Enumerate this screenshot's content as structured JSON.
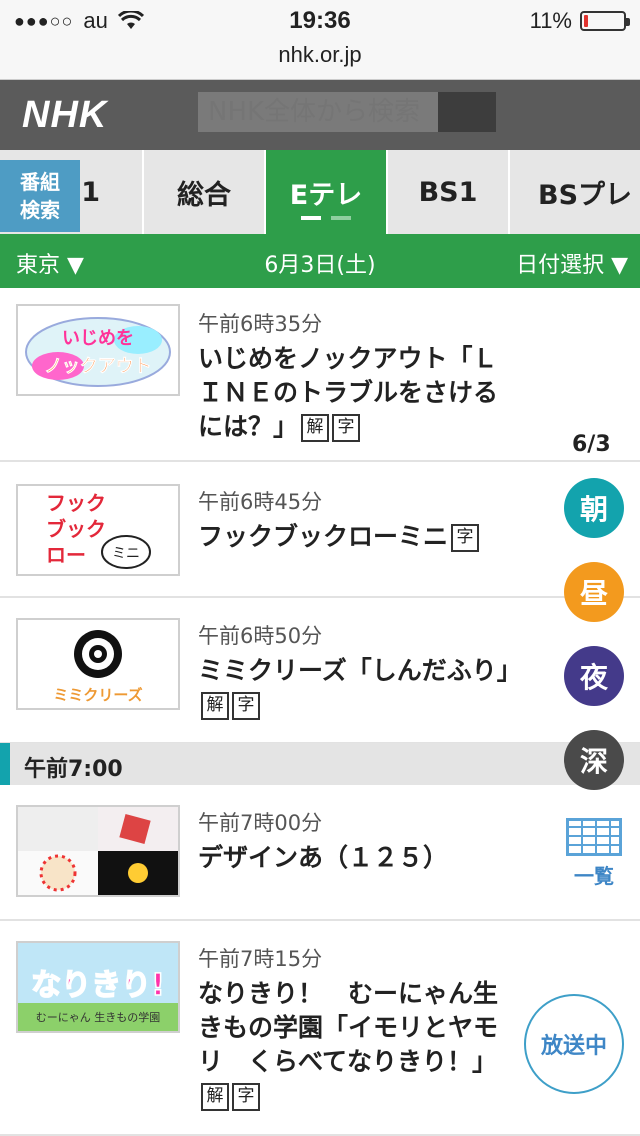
{
  "status": {
    "carrier": "au",
    "time": "19:36",
    "battery": "11%",
    "battery_level": 0.11,
    "signal": "●●●○○"
  },
  "browser": {
    "url": "nhk.or.jp"
  },
  "header": {
    "logo": "NHK",
    "search_placeholder": "NHK全体から検索"
  },
  "search_program": {
    "label_line1": "番組",
    "label_line2": "検索"
  },
  "tabs": [
    {
      "label": "1",
      "active": false
    },
    {
      "label": "総合",
      "active": false
    },
    {
      "label": "Eテレ",
      "active": true
    },
    {
      "label": "BS1",
      "active": false
    },
    {
      "label": "BSプレ",
      "active": false
    }
  ],
  "datebar": {
    "region": "東京 ▼",
    "date": "6月3日(土)",
    "select": "日付選択 ▼"
  },
  "programs": [
    {
      "time": "午前6時35分",
      "title": "いじめをノックアウト「ＬＩＮＥのトラブルをさけるには？」",
      "badges": [
        "解",
        "字"
      ],
      "thumb": "いじめをノックアウト"
    },
    {
      "time": "午前6時45分",
      "title": "フックブックローミニ",
      "badges": [
        "字"
      ],
      "thumb": "フック ブック ロー ミニ"
    },
    {
      "time": "午前6時50分",
      "title": "ミミクリーズ「しんだふり」",
      "badges": [
        "解",
        "字"
      ],
      "thumb": "ミミクリーズ"
    },
    {
      "time": "午前7時00分",
      "title": "デザインあ（１２５）",
      "badges": [],
      "thumb": "デザインあ"
    },
    {
      "time": "午前7時15分",
      "title": "なりきり！　むーにゃん生きもの学園「イモリとヤモリ　くらべてなりきり！」",
      "badges": [
        "解",
        "字"
      ],
      "thumb": "なりきり!"
    }
  ],
  "hour_header": "午前7:00",
  "side_nav": {
    "page": "6/3",
    "morning": "朝",
    "noon": "昼",
    "night": "夜",
    "late": "深",
    "list": "一覧",
    "on_air": "放送中"
  },
  "colors": {
    "nhk_green": "#2e9e4a",
    "header_gray": "#5b5b5b",
    "accent_teal": "#13a3ad",
    "noon_orange": "#f39a1e",
    "night_purple": "#443a8a"
  }
}
